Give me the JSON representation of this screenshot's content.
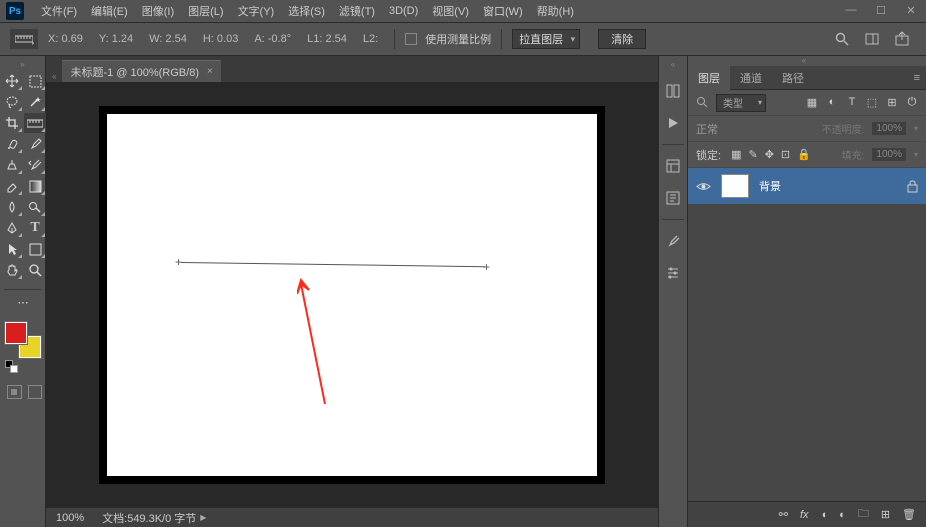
{
  "menu": {
    "items": [
      "文件(F)",
      "编辑(E)",
      "图像(I)",
      "图层(L)",
      "文字(Y)",
      "选择(S)",
      "滤镜(T)",
      "3D(D)",
      "视图(V)",
      "窗口(W)",
      "帮助(H)"
    ]
  },
  "options": {
    "x": "X: 0.69",
    "y": "Y: 1.24",
    "w": "W: 2.54",
    "h": "H: 0.03",
    "a": "A: -0.8°",
    "l1": "L1: 2.54",
    "l2": "L2:",
    "use_scale": "使用测量比例",
    "straighten": "拉直图层",
    "clear": "清除"
  },
  "doc": {
    "tab_title": "未标题-1 @ 100%(RGB/8)",
    "zoom": "100%",
    "status": "文档:549.3K/0 字节"
  },
  "swatch": {
    "fg": "#d81e1e",
    "bg": "#e8d427"
  },
  "panel": {
    "tabs": {
      "layers": "图层",
      "channels": "通道",
      "paths": "路径"
    },
    "filter": "类型",
    "blend": "正常",
    "opacity_label": "不透明度:",
    "opacity_val": "100%",
    "lock_label": "锁定:",
    "fill_label": "填充:",
    "fill_val": "100%",
    "layer_name": "背景"
  }
}
